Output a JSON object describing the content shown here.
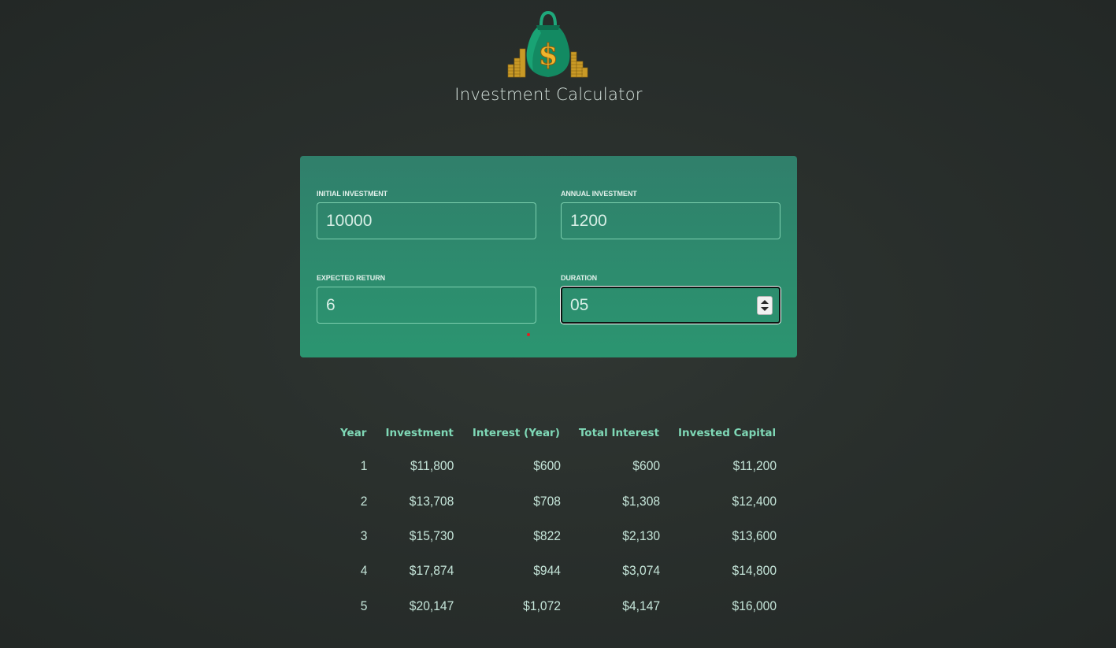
{
  "header": {
    "title": "Investment Calculator",
    "logo_icon": "money-bag-dollar-icon"
  },
  "inputs": {
    "initial_investment": {
      "label": "Initial Investment",
      "value": "10000"
    },
    "annual_investment": {
      "label": "Annual Investment",
      "value": "1200"
    },
    "expected_return": {
      "label": "Expected Return",
      "value": "6"
    },
    "duration": {
      "label": "Duration",
      "value": "05"
    }
  },
  "results": {
    "headers": [
      "Year",
      "Investment",
      "Interest (Year)",
      "Total Interest",
      "Invested Capital"
    ],
    "rows": [
      [
        "1",
        "$11,800",
        "$600",
        "$600",
        "$11,200"
      ],
      [
        "2",
        "$13,708",
        "$708",
        "$1,308",
        "$12,400"
      ],
      [
        "3",
        "$15,730",
        "$822",
        "$2,130",
        "$13,600"
      ],
      [
        "4",
        "$17,874",
        "$944",
        "$3,074",
        "$14,800"
      ],
      [
        "5",
        "$20,147",
        "$1,072",
        "$4,147",
        "$16,000"
      ]
    ]
  },
  "colors": {
    "background": "#2a302d",
    "panel_top": "#307f6b",
    "panel_bottom": "#2b9570",
    "header_text": "#7fd8b6",
    "cell_text": "#c5e5d9",
    "title_text": "#d6e3de"
  }
}
